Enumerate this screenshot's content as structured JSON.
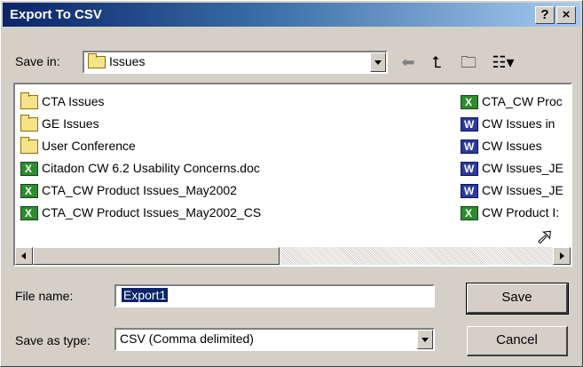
{
  "window": {
    "title": "Export To CSV",
    "help_btn": "?",
    "close_btn": "×"
  },
  "save_in": {
    "label": "Save in:",
    "value": "Issues"
  },
  "toolbar": {
    "icons": [
      "back-arrow-icon",
      "up-folder-icon",
      "new-folder-icon",
      "views-menu-icon"
    ]
  },
  "files": {
    "left": [
      {
        "name": "CTA Issues",
        "type": "folder"
      },
      {
        "name": "GE Issues",
        "type": "folder"
      },
      {
        "name": "User Conference",
        "type": "folder"
      },
      {
        "name": "Citadon CW 6.2 Usability Concerns.doc",
        "type": "xls"
      },
      {
        "name": "CTA_CW Product Issues_May2002",
        "type": "xls"
      },
      {
        "name": "CTA_CW Product Issues_May2002_CS",
        "type": "xls"
      }
    ],
    "right": [
      {
        "name": "CTA_CW Proc",
        "type": "xls"
      },
      {
        "name": "CW Issues in",
        "type": "doc"
      },
      {
        "name": "CW Issues",
        "type": "doc"
      },
      {
        "name": "CW Issues_JE",
        "type": "doc"
      },
      {
        "name": "CW Issues_JE",
        "type": "doc"
      },
      {
        "name": "CW Product I:",
        "type": "xls"
      }
    ]
  },
  "file_name": {
    "label": "File name:",
    "value": "Export1"
  },
  "save_as_type": {
    "label": "Save as type:",
    "value": "CSV (Comma delimited)"
  },
  "buttons": {
    "save": "Save",
    "cancel": "Cancel"
  }
}
